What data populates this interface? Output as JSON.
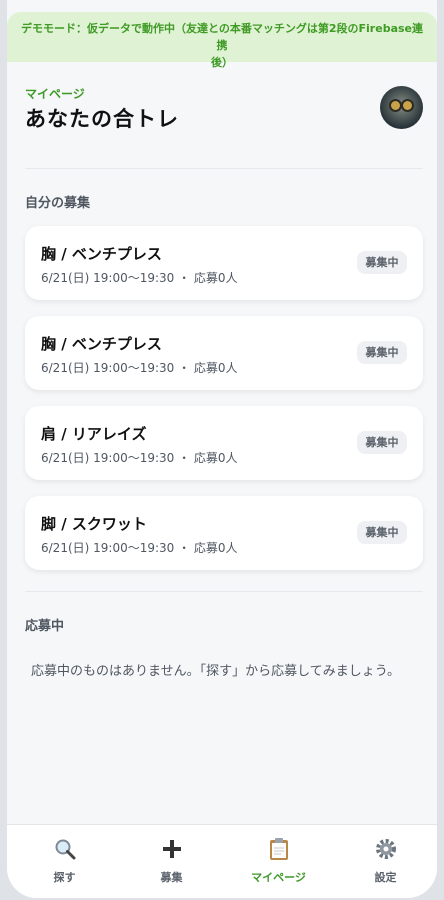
{
  "banner": {
    "line1": "デモモード：仮データで動作中（友達との本番マッチングは第2段のFirebase連携",
    "line2": "後）"
  },
  "header": {
    "subtitle": "マイページ",
    "title": "あなたの合トレ"
  },
  "my_posts": {
    "title": "自分の募集",
    "items": [
      {
        "title": "胸 / ベンチプレス",
        "meta": "6/21(日) 19:00〜19:30 ・ 応募0人",
        "status": "募集中"
      },
      {
        "title": "胸 / ベンチプレス",
        "meta": "6/21(日) 19:00〜19:30 ・ 応募0人",
        "status": "募集中"
      },
      {
        "title": "肩 / リアレイズ",
        "meta": "6/21(日) 19:00〜19:30 ・ 応募0人",
        "status": "募集中"
      },
      {
        "title": "脚 / スクワット",
        "meta": "6/21(日) 19:00〜19:30 ・ 応募0人",
        "status": "募集中"
      }
    ]
  },
  "applying": {
    "title": "応募中",
    "empty_text": "応募中のものはありません。「探す」から応募してみましょう。"
  },
  "tabs": [
    {
      "label": "探す",
      "icon": "search-icon"
    },
    {
      "label": "募集",
      "icon": "plus-icon"
    },
    {
      "label": "マイページ",
      "icon": "clipboard-icon",
      "active": true
    },
    {
      "label": "設定",
      "icon": "gear-icon"
    }
  ],
  "colors": {
    "accent": "#3e9a27",
    "banner_bg": "#dff2d3"
  }
}
